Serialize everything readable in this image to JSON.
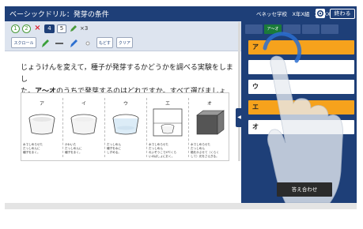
{
  "app": {
    "title": "ベーシックドリル：発芽の条件",
    "school": "ベネッセ学校　X年X組　XX XX",
    "end_button": "終わる"
  },
  "toolbar": {
    "steps": [
      "1",
      "2",
      "×",
      "4",
      "5"
    ],
    "pencil_count": "×3",
    "tools": [
      "スクロール",
      "消しゴム",
      "もどす",
      "クリア"
    ]
  },
  "question": {
    "line1": "じょうけんを変えて，種子が発芽するかどうかを調べる実験をしまし",
    "line2_prefix": "た。",
    "line2_bold": "ア〜オ",
    "line2_suffix": "のうちで発芽するのはどれですか。すべて選びましょう。"
  },
  "figure": {
    "labels": [
      "ア",
      "イ",
      "ウ",
      "エ",
      "オ"
    ],
    "captions": [
      [
        "水でしめらせた",
        "だっしめんに",
        "種子をまく。"
      ],
      [
        "かわいた",
        "だっしめんに",
        "種子をまく。"
      ],
      [
        "だっしめん",
        "",
        "種子を水に",
        "しずめる。"
      ],
      [
        "水でしめらせた",
        "だっしめん",
        "",
        "れいぞうこで4℃くら",
        "いのばしょにおく。"
      ],
      [
        "水でしめらせた",
        "だっしめん",
        "",
        "箱をかぶせて（くらく",
        "して）光をさえぎる。"
      ]
    ]
  },
  "panel": {
    "tabs": [
      "",
      "ア〜オ",
      "",
      "",
      ""
    ],
    "choices": [
      {
        "label": "ア",
        "selected": true
      },
      {
        "label": "",
        "selected": false
      },
      {
        "label": "ウ",
        "selected": false
      },
      {
        "label": "エ",
        "selected": true
      },
      {
        "label": "オ",
        "selected": false
      }
    ],
    "check_button": "答え合わせ"
  },
  "colors": {
    "navy": "#1e3f78",
    "selected": "#f6a21c",
    "accent_green": "#1a7a3a"
  }
}
